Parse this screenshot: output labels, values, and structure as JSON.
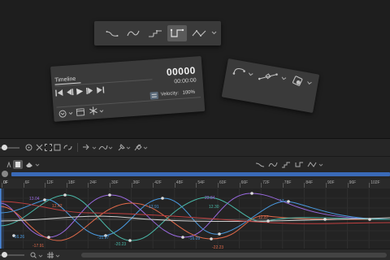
{
  "interp_toolbar": {
    "icons": [
      "ease-in-out-icon",
      "bezier-icon",
      "stepped-icon",
      "constant-step-icon",
      "linear-icon",
      "chevron-down-icon"
    ],
    "active_index": 3
  },
  "handles_toolbar": {
    "icons": [
      "handle-curve-icon",
      "chevron-down-icon",
      "handle-tangent-icon",
      "chevron-down-icon",
      "snap-key-icon",
      "chevron-down-icon"
    ]
  },
  "timeline_panel": {
    "title": "Timeline",
    "frame_number": "00000",
    "timecode": "00:00:00",
    "velocity_label": "Velocity:",
    "velocity_value": "100%",
    "transport": [
      "jump-start-icon",
      "step-back-icon",
      "play-icon",
      "step-forward-icon",
      "jump-end-icon"
    ]
  },
  "bottom_toolbar": {
    "zoom_level": 0.1
  },
  "ruler": {
    "labels": [
      "0F",
      "6F",
      "12F",
      "18F",
      "24F",
      "30F",
      "36F",
      "42F",
      "48F",
      "54F",
      "60F",
      "66F",
      "72F",
      "78F",
      "84F",
      "90F",
      "96F",
      "102F"
    ]
  },
  "graph": {
    "curve_labels": [
      {
        "text": "13.04",
        "color": "#9a6ae0"
      },
      {
        "text": "12.42",
        "color": "#e06a4a"
      },
      {
        "text": "12.91",
        "color": "#4a9ae0"
      },
      {
        "text": "23.84",
        "color": "#9a6ae0"
      },
      {
        "text": "12.30",
        "color": "#4ab8a8"
      },
      {
        "text": "17",
        "color": "#4a9ae0"
      },
      {
        "text": "12.87",
        "color": "#e06a4a"
      },
      {
        "text": "-16.26",
        "color": "#4a9ae0"
      },
      {
        "text": "-17.91",
        "color": "#e06a4a"
      },
      {
        "text": "-10.97",
        "color": "#4a9ae0"
      },
      {
        "text": "-20.23",
        "color": "#4ab8a8"
      },
      {
        "text": "-16.09",
        "color": "#4a9ae0"
      },
      {
        "text": "-22.23",
        "color": "#e06a4a"
      }
    ],
    "current_frame_marker": "0F"
  }
}
